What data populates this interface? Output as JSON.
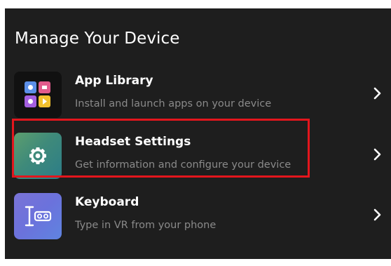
{
  "section": {
    "title": "Manage Your Device"
  },
  "items": [
    {
      "name": "App Library",
      "description": "Install and launch apps on your device",
      "icon": "app-grid-icon"
    },
    {
      "name": "Headset Settings",
      "description": "Get information and configure your device",
      "icon": "gear-icon"
    },
    {
      "name": "Keyboard",
      "description": "Type in VR from your phone",
      "icon": "keyboard-vr-icon"
    }
  ],
  "colors": {
    "background": "#1e1e1e",
    "highlight_border": "#e3161d",
    "title_text": "#ffffff",
    "description_text": "#8a8a8a"
  }
}
